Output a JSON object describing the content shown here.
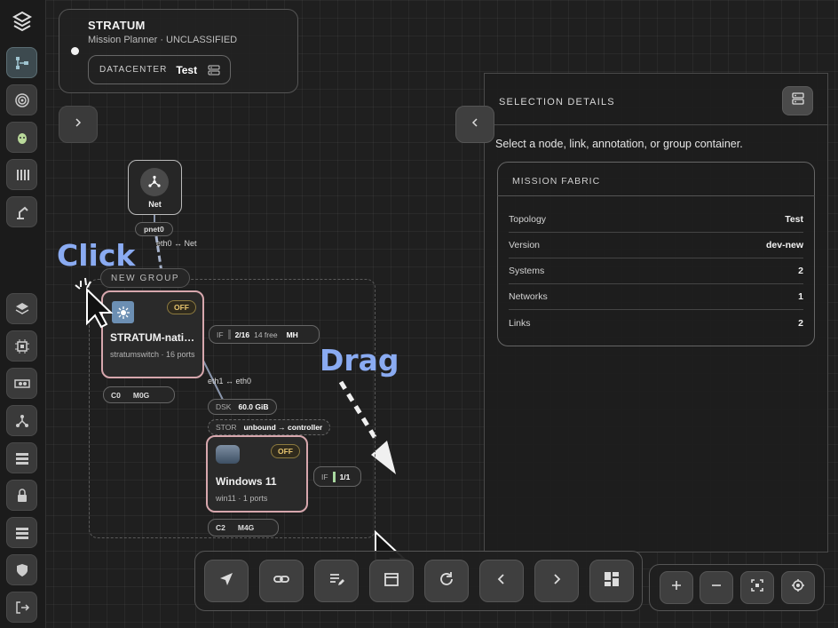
{
  "app": {
    "title": "STRATUM",
    "subtitle": "Mission Planner · UNCLASSIFIED",
    "datacenter_label": "DATACENTER",
    "datacenter_value": "Test"
  },
  "sidebar": {
    "items": [
      {
        "icon": "stratum-logo-icon"
      },
      {
        "icon": "topology-icon",
        "active": true
      },
      {
        "icon": "target-icon"
      },
      {
        "icon": "bug-icon"
      },
      {
        "icon": "inventory-icon"
      },
      {
        "icon": "robot-arm-icon"
      },
      {
        "icon": "layers-icon"
      },
      {
        "icon": "chip-icon"
      },
      {
        "icon": "gpu-card-icon"
      },
      {
        "icon": "network-icon"
      },
      {
        "icon": "server-list-icon"
      },
      {
        "icon": "lock-icon"
      },
      {
        "icon": "storage-icon"
      },
      {
        "icon": "shield-icon"
      },
      {
        "icon": "logout-icon"
      }
    ]
  },
  "panel": {
    "title": "SELECTION DETAILS",
    "hint": "Select a node, link, annotation, or group container.",
    "fabric": {
      "title": "MISSION FABRIC",
      "rows": [
        {
          "key": "Topology",
          "value": "Test"
        },
        {
          "key": "Version",
          "value": "dev-new"
        },
        {
          "key": "Systems",
          "value": "2"
        },
        {
          "key": "Networks",
          "value": "1"
        },
        {
          "key": "Links",
          "value": "2"
        }
      ]
    }
  },
  "canvas": {
    "net_node": {
      "label": "Net",
      "port": "pnet0",
      "edge_label": "eth0 ↔ Net"
    },
    "group": {
      "label": "NEW GROUP"
    },
    "switch_node": {
      "badge": "OFF",
      "name": "STRATUM-nati…",
      "sub": "stratumswitch · 16 ports",
      "cpu_label": "C0",
      "mem_label": "M0G",
      "if_label": "IF",
      "if_value": "2/16",
      "if_free": "14 free",
      "if_extra": "MH"
    },
    "link_label": "eth1 ↔ eth0",
    "win_node": {
      "badge": "OFF",
      "name": "Windows 11",
      "sub": "win11 · 1 ports",
      "dsk_label": "DSK",
      "dsk_value": "60.0 GiB",
      "stor_label": "STOR",
      "stor_value": "unbound → controller",
      "if_label": "IF",
      "if_value": "1/1",
      "cpu_label": "C2",
      "mem_label": "M4G"
    }
  },
  "annotations": {
    "click": "Click",
    "drag": "Drag"
  },
  "colors": {
    "accent_annotation": "#8aabf2",
    "node_border": "#d7a7ad",
    "badge_off": "#e6c46e"
  }
}
